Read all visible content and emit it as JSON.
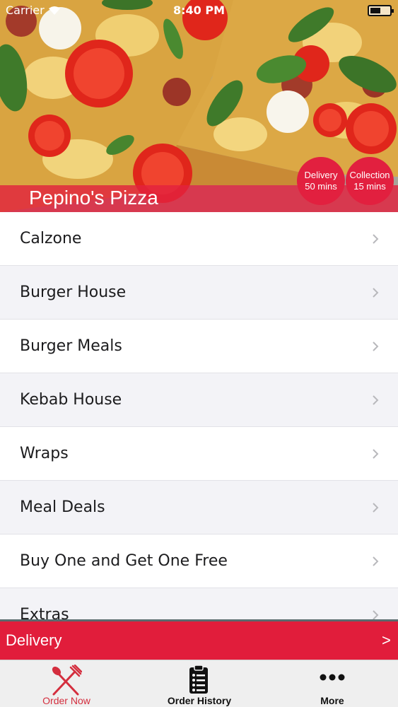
{
  "status_bar": {
    "carrier": "Carrier",
    "time": "8:40 PM"
  },
  "header": {
    "restaurant_name": "Pepino's Pizza",
    "delivery_badge": {
      "label": "Delivery",
      "time": "50 mins"
    },
    "collection_badge": {
      "label": "Collection",
      "time": "15 mins"
    }
  },
  "menu": {
    "items": [
      {
        "label": "Calzone"
      },
      {
        "label": "Burger House"
      },
      {
        "label": "Burger Meals"
      },
      {
        "label": "Kebab House"
      },
      {
        "label": "Wraps"
      },
      {
        "label": "Meal Deals"
      },
      {
        "label": "Buy One and Get One Free"
      },
      {
        "label": "Extras"
      }
    ]
  },
  "delivery_bar": {
    "label": "Delivery",
    "arrow": ">"
  },
  "tab_bar": {
    "tabs": [
      {
        "label": "Order Now",
        "icon": "fork-knife-icon",
        "active": true
      },
      {
        "label": "Order History",
        "icon": "clipboard-list-icon",
        "active": false
      },
      {
        "label": "More",
        "icon": "ellipsis-icon",
        "active": false
      }
    ]
  },
  "colors": {
    "accent": "#e11d3b",
    "tab_active": "#d42e3e",
    "alt_row": "#f3f3f7"
  }
}
